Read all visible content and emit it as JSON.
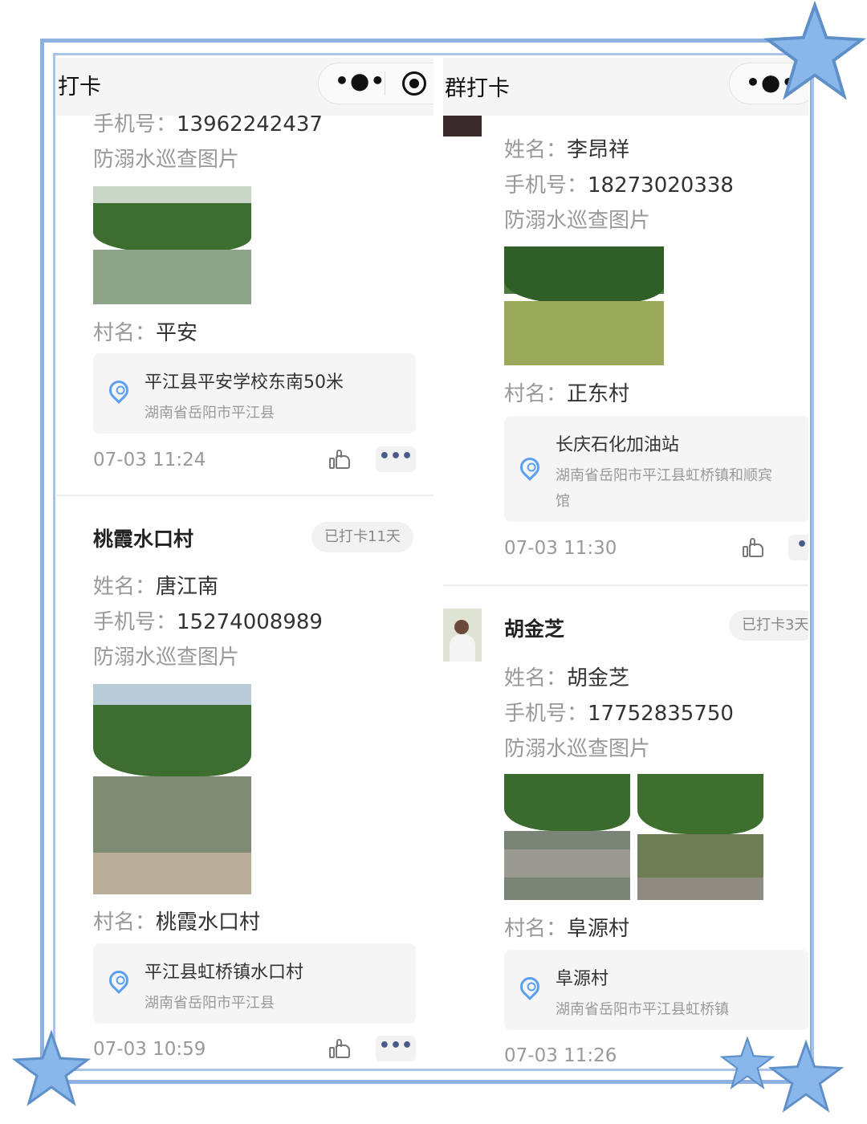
{
  "left_panel": {
    "title": "打卡",
    "capsule": {
      "more_icon": "more-dots-icon",
      "record_icon": "target-icon"
    },
    "card1": {
      "phone_label": "手机号：",
      "phone": "13962242437",
      "pics_label": "防溺水巡查图片",
      "village_label": "村名：",
      "village": "平安",
      "location": {
        "name": "平江县平安学校东南50米",
        "address": "湖南省岳阳市平江县"
      },
      "time": "07-03 11:24",
      "more": "•••"
    },
    "card2": {
      "title": "桃霞水口村",
      "badge": "已打卡11天",
      "name_label": "姓名：",
      "name": "唐江南",
      "phone_label": "手机号：",
      "phone": "15274008989",
      "pics_label": "防溺水巡查图片",
      "village_label": "村名：",
      "village": "桃霞水口村",
      "location": {
        "name": "平江县虹桥镇水口村",
        "address": "湖南省岳阳市平江县"
      },
      "time": "07-03 10:59",
      "more": "•••"
    }
  },
  "right_panel": {
    "title": "群打卡",
    "card1": {
      "name_label": "姓名：",
      "name": "李昂祥",
      "phone_label": "手机号：",
      "phone": "18273020338",
      "pics_label": "防溺水巡查图片",
      "village_label": "村名：",
      "village": "正东村",
      "location": {
        "name": "长庆石化加油站",
        "address_1": "湖南省岳阳市平江县虹桥镇和顺宾",
        "address_2": "馆"
      },
      "time": "07-03 11:30"
    },
    "card2": {
      "title": "胡金芝",
      "badge": "已打卡3天",
      "name_label": "姓名：",
      "name": "胡金芝",
      "phone_label": "手机号：",
      "phone": "17752835750",
      "pics_label": "防溺水巡查图片",
      "village_label": "村名：",
      "village": "阜源村",
      "location": {
        "name": "阜源村",
        "address": "湖南省岳阳市平江县虹桥镇"
      },
      "time": "07-03 11:26"
    }
  },
  "colors": {
    "frame": "#8fb1e0",
    "star": "#8ab7ea",
    "pin": "#5aa0f0"
  }
}
